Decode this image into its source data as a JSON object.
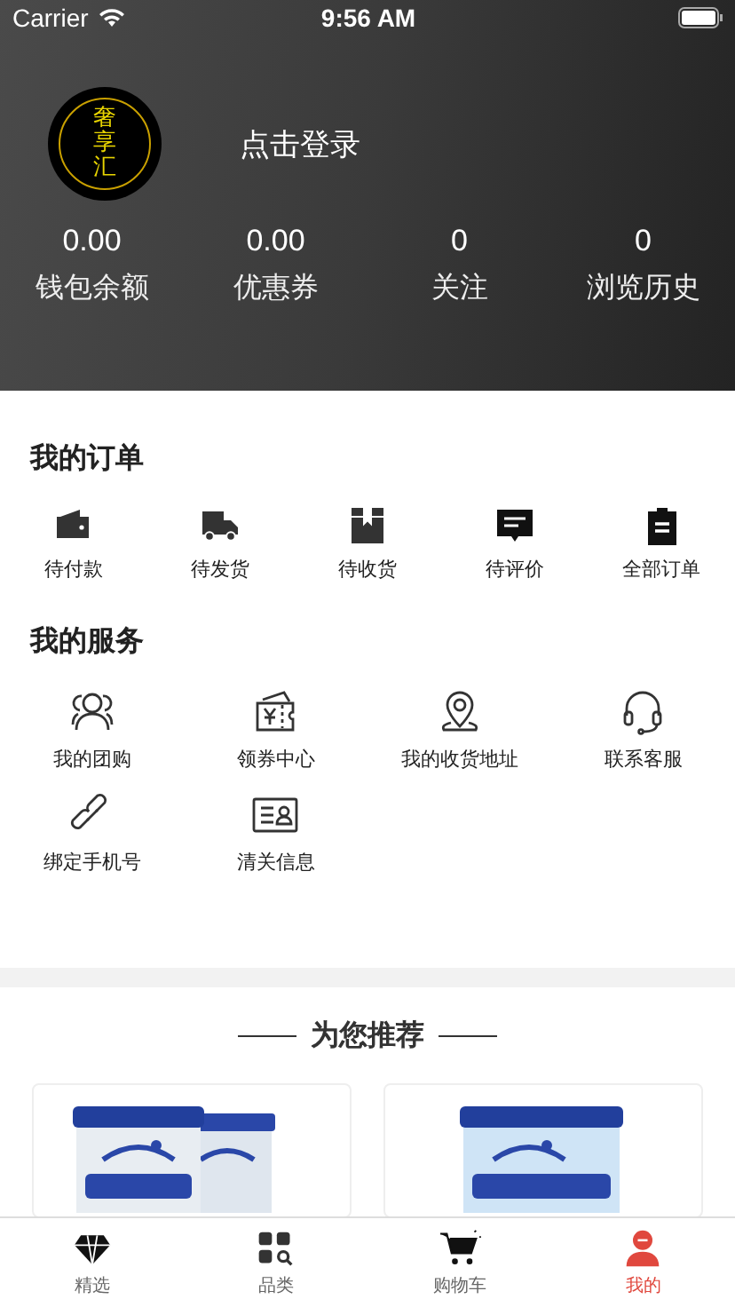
{
  "status_bar": {
    "carrier": "Carrier",
    "time": "9:56 AM"
  },
  "profile": {
    "logo_text": "奢享汇",
    "login": "点击登录",
    "stats": [
      {
        "value": "0.00",
        "label": "钱包余额"
      },
      {
        "value": "0.00",
        "label": "优惠券"
      },
      {
        "value": "0",
        "label": "关注"
      },
      {
        "value": "0",
        "label": "浏览历史"
      }
    ]
  },
  "orders": {
    "title": "我的订单",
    "items": [
      {
        "kind": "wallet",
        "label": "待付款"
      },
      {
        "kind": "truck",
        "label": "待发货"
      },
      {
        "kind": "box",
        "label": "待收货"
      },
      {
        "kind": "comment",
        "label": "待评价"
      },
      {
        "kind": "clipboard",
        "label": "全部订单"
      }
    ]
  },
  "services": {
    "title": "我的服务",
    "items": [
      {
        "kind": "people",
        "label": "我的团购"
      },
      {
        "kind": "ticket",
        "label": "领券中心"
      },
      {
        "kind": "pin",
        "label": "我的收货地址"
      },
      {
        "kind": "headset",
        "label": "联系客服"
      },
      {
        "kind": "link",
        "label": "绑定手机号"
      },
      {
        "kind": "idcard",
        "label": "清关信息"
      }
    ]
  },
  "recommend": {
    "title": "为您推荐"
  },
  "tab_bar": [
    {
      "kind": "diamond",
      "label": "精选",
      "selected": false
    },
    {
      "kind": "grid",
      "label": "品类",
      "selected": false
    },
    {
      "kind": "cart",
      "label": "购物车",
      "selected": false
    },
    {
      "kind": "person",
      "label": "我的",
      "selected": true
    }
  ]
}
